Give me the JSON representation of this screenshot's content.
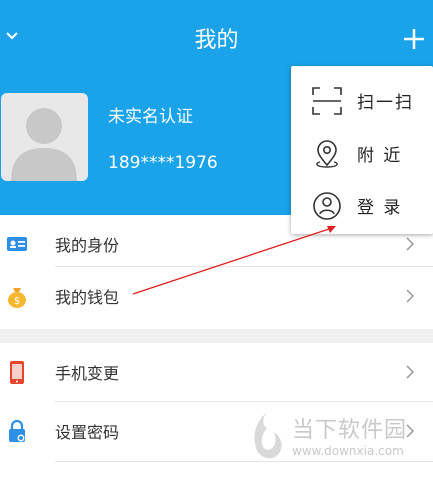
{
  "header": {
    "title": "我的",
    "collapse_icon": "chevron-down-icon",
    "add_icon": "plus-icon",
    "background": "#1aa3e8"
  },
  "profile": {
    "name": "未实名认证",
    "phone": "189****1976"
  },
  "menu": {
    "items": [
      {
        "label": "我的身份",
        "icon": "id-card-icon"
      },
      {
        "label": "我的钱包",
        "icon": "money-bag-icon"
      },
      {
        "label": "手机变更",
        "icon": "phone-icon"
      },
      {
        "label": "设置密码",
        "icon": "lock-icon"
      }
    ]
  },
  "popup": {
    "items": [
      {
        "label": "扫一扫",
        "icon": "scan-icon"
      },
      {
        "label": "附 近",
        "icon": "location-pin-icon"
      },
      {
        "label": "登 录",
        "icon": "user-circle-icon"
      }
    ]
  },
  "watermark": {
    "cn": "当下软件园",
    "url": "www.downxia.com"
  }
}
